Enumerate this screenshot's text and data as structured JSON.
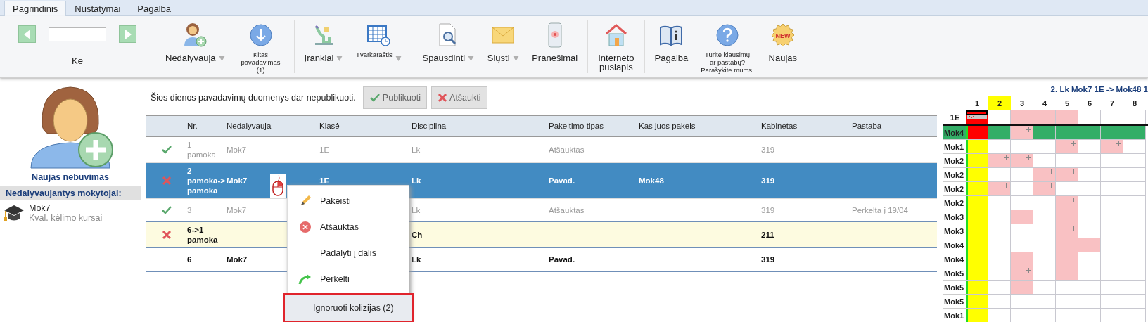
{
  "tabs": [
    {
      "label": "Pagrindinis",
      "selected": true
    },
    {
      "label": "Nustatymai",
      "selected": false
    },
    {
      "label": "Pagalba",
      "selected": false
    }
  ],
  "navigator": {
    "label": "Ke"
  },
  "toolbar_groups": [
    [
      {
        "kind": "person-add",
        "lines": [
          "Nedalyvauja"
        ],
        "dropdown": true,
        "compact": false
      },
      {
        "kind": "down-circle",
        "lines": [
          "Kitas",
          "pavadavimas",
          "(1)"
        ],
        "dropdown": false,
        "compact": true
      }
    ],
    [
      {
        "kind": "figure",
        "lines": [
          "Įrankiai"
        ],
        "dropdown": true,
        "compact": false
      },
      {
        "kind": "calendar",
        "lines": [
          "Tvarkaraštis"
        ],
        "dropdown": true,
        "compact": true
      }
    ],
    [
      {
        "kind": "document-search",
        "lines": [
          "Spausdinti"
        ],
        "dropdown": true,
        "compact": false
      },
      {
        "kind": "envelope",
        "lines": [
          "Siųsti"
        ],
        "dropdown": true,
        "compact": false
      },
      {
        "kind": "phone",
        "lines": [
          "Pranešimai"
        ],
        "dropdown": false,
        "compact": false
      }
    ],
    [
      {
        "kind": "house",
        "lines": [
          "Interneto",
          "puslapis"
        ],
        "dropdown": false,
        "compact": false
      }
    ],
    [
      {
        "kind": "book",
        "lines": [
          "Pagalba"
        ],
        "dropdown": false,
        "compact": false
      },
      {
        "kind": "help",
        "lines": [
          "Turite klausimų",
          "ar pastabų?",
          "Parašykite mums."
        ],
        "dropdown": false,
        "compact": true
      },
      {
        "kind": "new",
        "badge": "NEW",
        "lines": [
          "Naujas"
        ],
        "dropdown": false,
        "compact": false
      }
    ]
  ],
  "sidebar": {
    "action": "Naujas nebuvimas",
    "section": "Nedalyvaujantys mokytojai:",
    "teachers": [
      {
        "name": "Mok7",
        "reason": "Kval. kėlimo kursai"
      }
    ]
  },
  "notice": {
    "text": "Šios dienos pavadavimų duomenys dar nepublikuoti.",
    "buttons": [
      {
        "kind": "publish",
        "label": "Publikuoti"
      },
      {
        "kind": "cancel",
        "label": "Atšaukti"
      }
    ]
  },
  "table": {
    "columns": [
      "Nr.",
      "Nedalyvauja",
      "Klasė",
      "Disciplina",
      "Pakeitimo tipas",
      "Kas juos pakeis",
      "Kabinetas",
      "Pastaba"
    ],
    "rows": [
      {
        "approved": true,
        "kind": "cancelled",
        "selected": false,
        "nr": [
          "1",
          "pamoka"
        ],
        "absent": "Mok7",
        "class": "1E",
        "subject": "Lk",
        "change_type": "Atšauktas",
        "room": "319"
      },
      {
        "approved": false,
        "kind": "normal",
        "selected": true,
        "nr": [
          "2",
          "pamoka->",
          "pamoka"
        ],
        "absent": "Mok7",
        "class": "1E",
        "subject": "Lk",
        "change_type": "Pavad.",
        "substitute": "Mok48",
        "room": "319"
      },
      {
        "approved": true,
        "kind": "cancelled",
        "selected": false,
        "nr": [
          "3"
        ],
        "absent": "Mok7",
        "subject": "Lk",
        "change_type": "Atšauktas",
        "room": "319",
        "note": "Perkelta į 19/04"
      },
      {
        "approved": false,
        "kind": "pending",
        "selected": false,
        "nr": [
          "6->1",
          "pamoka"
        ],
        "subject": "Ch",
        "room": "211"
      },
      {
        "kind": "normal",
        "selected": false,
        "nr": [
          "6"
        ],
        "absent": "Mok7",
        "subject": "Lk",
        "change_type": "Pavad.",
        "room": "319"
      }
    ]
  },
  "context_menu": {
    "items": [
      {
        "kind": "pencil",
        "label": "Pakeisti",
        "highlighted": false
      },
      {
        "kind": "cancel",
        "label": "Atšauktas",
        "highlighted": false
      },
      {
        "kind": "plain",
        "label": "Padalyti į dalis",
        "highlighted": false
      },
      {
        "kind": "arrow",
        "label": "Perkelti",
        "highlighted": false
      },
      {
        "kind": "plain",
        "label": "Ignoruoti kolizijas (2)",
        "highlighted": true
      }
    ]
  },
  "schedule": {
    "title": "2. Lk Mok7 1E -> Mok48 1",
    "columns": [
      {
        "label": "1",
        "selected": false
      },
      {
        "label": "2",
        "selected": true
      },
      {
        "label": "3",
        "selected": false
      },
      {
        "label": "4",
        "selected": false
      },
      {
        "label": "5",
        "selected": false
      },
      {
        "label": "6",
        "selected": false
      },
      {
        "label": "7",
        "selected": false
      },
      {
        "label": "8",
        "selected": false
      }
    ],
    "rows": [
      {
        "label": "1E",
        "selected": false,
        "cells": [
          {
            "kind": "lesson",
            "plus": false
          },
          {
            "kind": "empty",
            "plus": false
          },
          {
            "kind": "busy",
            "plus": false
          },
          {
            "kind": "busy",
            "plus": false
          },
          {
            "kind": "busy",
            "plus": false
          },
          {
            "kind": "empty",
            "plus": false
          },
          {
            "kind": "empty",
            "plus": false
          },
          {
            "kind": "empty",
            "plus": false
          }
        ]
      },
      {
        "label": "Mok4",
        "selected": true,
        "cells": [
          {
            "kind": "conflict",
            "plus": false
          },
          {
            "kind": "free",
            "plus": false
          },
          {
            "kind": "busy",
            "plus": true
          },
          {
            "kind": "free",
            "plus": false
          },
          {
            "kind": "free",
            "plus": false
          },
          {
            "kind": "free",
            "plus": false
          },
          {
            "kind": "free",
            "plus": false
          },
          {
            "kind": "free",
            "plus": false
          }
        ]
      },
      {
        "label": "Mok1",
        "selected": false,
        "cells": [
          {
            "kind": "current",
            "plus": false
          },
          {
            "kind": "empty",
            "plus": false
          },
          {
            "kind": "empty",
            "plus": false
          },
          {
            "kind": "empty",
            "plus": false
          },
          {
            "kind": "busy",
            "plus": true
          },
          {
            "kind": "empty",
            "plus": false
          },
          {
            "kind": "busy",
            "plus": true
          },
          {
            "kind": "empty",
            "plus": false
          }
        ]
      },
      {
        "label": "Mok2",
        "selected": false,
        "cells": [
          {
            "kind": "current",
            "plus": false
          },
          {
            "kind": "busy",
            "plus": true
          },
          {
            "kind": "busy",
            "plus": true
          },
          {
            "kind": "empty",
            "plus": false
          },
          {
            "kind": "empty",
            "plus": false
          },
          {
            "kind": "empty",
            "plus": false
          },
          {
            "kind": "empty",
            "plus": false
          },
          {
            "kind": "empty",
            "plus": false
          }
        ]
      },
      {
        "label": "Mok2",
        "selected": false,
        "cells": [
          {
            "kind": "current",
            "plus": false
          },
          {
            "kind": "empty",
            "plus": false
          },
          {
            "kind": "empty",
            "plus": false
          },
          {
            "kind": "busy",
            "plus": true
          },
          {
            "kind": "busy",
            "plus": true
          },
          {
            "kind": "empty",
            "plus": false
          },
          {
            "kind": "empty",
            "plus": false
          },
          {
            "kind": "empty",
            "plus": false
          }
        ]
      },
      {
        "label": "Mok2",
        "selected": false,
        "cells": [
          {
            "kind": "current",
            "plus": false
          },
          {
            "kind": "busy",
            "plus": true
          },
          {
            "kind": "empty",
            "plus": false
          },
          {
            "kind": "busy",
            "plus": true
          },
          {
            "kind": "empty",
            "plus": false
          },
          {
            "kind": "empty",
            "plus": false
          },
          {
            "kind": "empty",
            "plus": false
          },
          {
            "kind": "empty",
            "plus": false
          }
        ]
      },
      {
        "label": "Mok2",
        "selected": false,
        "cells": [
          {
            "kind": "current",
            "plus": false
          },
          {
            "kind": "empty",
            "plus": false
          },
          {
            "kind": "empty",
            "plus": false
          },
          {
            "kind": "empty",
            "plus": false
          },
          {
            "kind": "busy",
            "plus": true
          },
          {
            "kind": "empty",
            "plus": false
          },
          {
            "kind": "empty",
            "plus": false
          },
          {
            "kind": "empty",
            "plus": false
          }
        ]
      },
      {
        "label": "Mok3",
        "selected": false,
        "cells": [
          {
            "kind": "current",
            "plus": false
          },
          {
            "kind": "empty",
            "plus": false
          },
          {
            "kind": "busy",
            "plus": false
          },
          {
            "kind": "empty",
            "plus": false
          },
          {
            "kind": "busy",
            "plus": false
          },
          {
            "kind": "empty",
            "plus": false
          },
          {
            "kind": "empty",
            "plus": false
          },
          {
            "kind": "empty",
            "plus": false
          }
        ]
      },
      {
        "label": "Mok3",
        "selected": false,
        "cells": [
          {
            "kind": "current",
            "plus": false
          },
          {
            "kind": "empty",
            "plus": false
          },
          {
            "kind": "empty",
            "plus": false
          },
          {
            "kind": "empty",
            "plus": false
          },
          {
            "kind": "busy",
            "plus": true
          },
          {
            "kind": "empty",
            "plus": false
          },
          {
            "kind": "empty",
            "plus": false
          },
          {
            "kind": "empty",
            "plus": false
          }
        ]
      },
      {
        "label": "Mok4",
        "selected": false,
        "cells": [
          {
            "kind": "current",
            "plus": false
          },
          {
            "kind": "empty",
            "plus": false
          },
          {
            "kind": "empty",
            "plus": false
          },
          {
            "kind": "empty",
            "plus": false
          },
          {
            "kind": "busy",
            "plus": false
          },
          {
            "kind": "busy",
            "plus": false
          },
          {
            "kind": "empty",
            "plus": false
          },
          {
            "kind": "empty",
            "plus": false
          }
        ]
      },
      {
        "label": "Mok4",
        "selected": false,
        "cells": [
          {
            "kind": "current",
            "plus": false
          },
          {
            "kind": "empty",
            "plus": false
          },
          {
            "kind": "busy",
            "plus": false
          },
          {
            "kind": "empty",
            "plus": false
          },
          {
            "kind": "busy",
            "plus": false
          },
          {
            "kind": "empty",
            "plus": false
          },
          {
            "kind": "empty",
            "plus": false
          },
          {
            "kind": "empty",
            "plus": false
          }
        ]
      },
      {
        "label": "Mok5",
        "selected": false,
        "cells": [
          {
            "kind": "current",
            "plus": false
          },
          {
            "kind": "empty",
            "plus": false
          },
          {
            "kind": "busy",
            "plus": true
          },
          {
            "kind": "empty",
            "plus": false
          },
          {
            "kind": "busy",
            "plus": false
          },
          {
            "kind": "empty",
            "plus": false
          },
          {
            "kind": "empty",
            "plus": false
          },
          {
            "kind": "empty",
            "plus": false
          }
        ]
      },
      {
        "label": "Mok5",
        "selected": false,
        "cells": [
          {
            "kind": "current",
            "plus": false
          },
          {
            "kind": "empty",
            "plus": false
          },
          {
            "kind": "busy",
            "plus": false
          },
          {
            "kind": "empty",
            "plus": false
          },
          {
            "kind": "empty",
            "plus": false
          },
          {
            "kind": "empty",
            "plus": false
          },
          {
            "kind": "empty",
            "plus": false
          },
          {
            "kind": "empty",
            "plus": false
          }
        ]
      },
      {
        "label": "Mok5",
        "selected": false,
        "cells": [
          {
            "kind": "current",
            "plus": false
          },
          {
            "kind": "empty",
            "plus": false
          },
          {
            "kind": "empty",
            "plus": false
          },
          {
            "kind": "empty",
            "plus": false
          },
          {
            "kind": "empty",
            "plus": false
          },
          {
            "kind": "empty",
            "plus": false
          },
          {
            "kind": "empty",
            "plus": false
          },
          {
            "kind": "empty",
            "plus": false
          }
        ]
      },
      {
        "label": "Mok1",
        "selected": false,
        "cells": [
          {
            "kind": "current",
            "plus": false
          },
          {
            "kind": "empty",
            "plus": false
          },
          {
            "kind": "empty",
            "plus": false
          },
          {
            "kind": "empty",
            "plus": false
          },
          {
            "kind": "empty",
            "plus": false
          },
          {
            "kind": "empty",
            "plus": false
          },
          {
            "kind": "empty",
            "plus": false
          },
          {
            "kind": "empty",
            "plus": false
          }
        ]
      }
    ]
  }
}
